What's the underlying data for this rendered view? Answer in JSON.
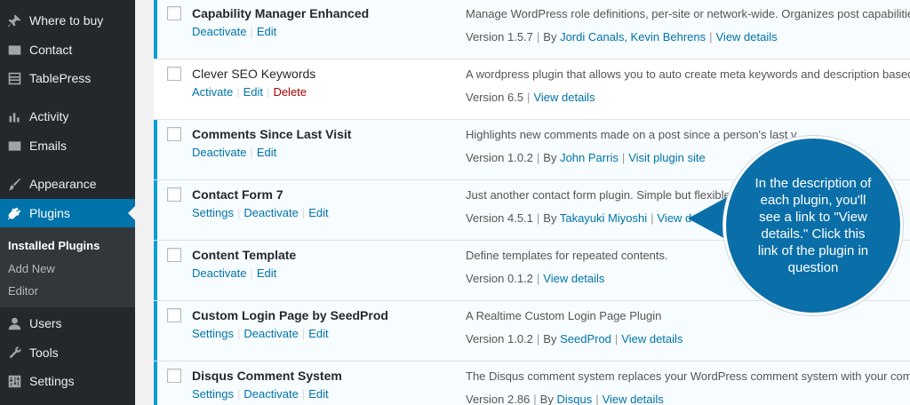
{
  "sidebar": {
    "items": [
      {
        "label": "Where to buy",
        "icon": "pin-icon"
      },
      {
        "label": "Contact",
        "icon": "envelope-icon"
      },
      {
        "label": "TablePress",
        "icon": "table-icon"
      },
      {
        "label": "Activity",
        "icon": "activity-icon"
      },
      {
        "label": "Emails",
        "icon": "envelope-icon"
      },
      {
        "label": "Appearance",
        "icon": "brush-icon"
      },
      {
        "label": "Plugins",
        "icon": "plug-icon"
      },
      {
        "label": "Users",
        "icon": "user-icon"
      },
      {
        "label": "Tools",
        "icon": "wrench-icon"
      },
      {
        "label": "Settings",
        "icon": "sliders-icon"
      }
    ],
    "submenu": [
      "Installed Plugins",
      "Add New",
      "Editor"
    ]
  },
  "plugins": [
    {
      "name": "Capability Manager Enhanced",
      "actions": [
        "Deactivate",
        "Edit"
      ],
      "description": "Manage WordPress role definitions, per-site or network-wide. Organizes post capabilities b",
      "version": "Version 1.5.7",
      "by": "By",
      "author": "Jordi Canals, Kevin Behrens",
      "link": "View details"
    },
    {
      "name": "Clever SEO Keywords",
      "actions": [
        "Activate",
        "Edit",
        "Delete"
      ],
      "description": "A wordpress plugin that allows you to auto create meta keywords and description based o",
      "version": "Version 6.5",
      "link": "View details"
    },
    {
      "name": "Comments Since Last Visit",
      "actions": [
        "Deactivate",
        "Edit"
      ],
      "description": "Highlights new comments made on a post since a person's last v",
      "version": "Version 1.0.2",
      "by": "By",
      "author": "John Parris",
      "link": "Visit plugin site"
    },
    {
      "name": "Contact Form 7",
      "actions": [
        "Settings",
        "Deactivate",
        "Edit"
      ],
      "description": "Just another contact form plugin. Simple but flexible.",
      "version": "Version 4.5.1",
      "by": "By",
      "author": "Takayuki Miyoshi",
      "link": "View deta"
    },
    {
      "name": "Content Template",
      "actions": [
        "Deactivate",
        "Edit"
      ],
      "description": "Define templates for repeated contents.",
      "version": "Version 0.1.2",
      "link": "View details"
    },
    {
      "name": "Custom Login Page by SeedProd",
      "actions": [
        "Settings",
        "Deactivate",
        "Edit"
      ],
      "description": "A Realtime Custom Login Page Plugin",
      "version": "Version 1.0.2",
      "by": "By",
      "author": "SeedProd",
      "link": "View details"
    },
    {
      "name": "Disqus Comment System",
      "actions": [
        "Settings",
        "Deactivate",
        "Edit"
      ],
      "description": "The Disqus comment system replaces your WordPress comment system with your comme",
      "version": "Version 2.86",
      "by": "By",
      "author": "Disqus",
      "link": "View details"
    }
  ],
  "callout": {
    "text": "In the description of each plugin, you'll see a link to \"View details.\" Click this link of the plugin in question"
  },
  "colors": {
    "sidebar": "#23282d",
    "active": "#0073aa",
    "link": "#0073aa",
    "active_border": "#00a0d2",
    "delete": "#a00",
    "callout": "#0a6fa8"
  }
}
